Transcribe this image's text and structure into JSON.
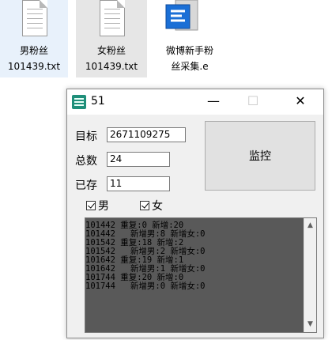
{
  "desktop": {
    "icons": [
      {
        "label1": "男粉丝",
        "label2": "101439.txt"
      },
      {
        "label1": "女粉丝",
        "label2": "101439.txt"
      },
      {
        "label1": "微博新手粉",
        "label2": "丝采集.e"
      }
    ]
  },
  "window": {
    "title": "51",
    "minimize_glyph": "—",
    "maximize_glyph": "☐",
    "close_glyph": "✕"
  },
  "form": {
    "target_label": "目标",
    "target_value": "2671109275",
    "total_label": "总数",
    "total_value": "24",
    "saved_label": "已存",
    "saved_value": "11",
    "monitor_button": "监控",
    "male_label": "男",
    "female_label": "女"
  },
  "log": {
    "lines": [
      "101442 重复:0 新增:20",
      "101442   新增男:8 新增女:0",
      "101542 重复:18 新增:2",
      "101542   新增男:2 新增女:0",
      "101642 重复:19 新增:1",
      "101642   新增男:1 新增女:0",
      "101744 重复:20 新增:0",
      "101744   新增男:0 新增女:0"
    ]
  },
  "colors": {
    "log_bg": "#595959",
    "window_bg": "#f0f0f0",
    "selection_a": "#e8f1fb",
    "selection_b": "#e6e6e6"
  }
}
